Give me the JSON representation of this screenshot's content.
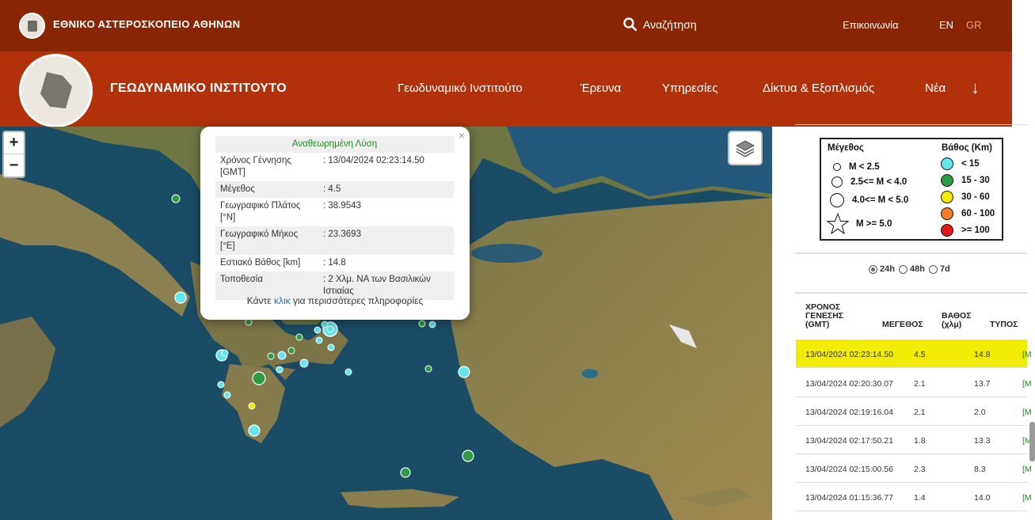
{
  "header": {
    "org_name": "ΕΘΝΙΚΟ ΑΣΤΕΡΟΣΚΟΠΕΙΟ ΑΘΗΝΩΝ",
    "search_label": "Αναζήτηση",
    "contact_label": "Επικοινωνία",
    "lang_en": "EN",
    "lang_gr": "GR"
  },
  "nav": {
    "institute_title": "ΓΕΩΔΥΝΑΜΙΚΟ ΙΝΣΤΙΤΟΥΤΟ",
    "items": [
      "Γεωδυναμικό Ινστιτούτο",
      "Έρευνα",
      "Υπηρεσίες",
      "Δίκτυα & Εξοπλισμός",
      "Νέα"
    ],
    "arrow": "↓"
  },
  "map": {
    "zoom_in": "+",
    "zoom_out": "−",
    "popup": {
      "close": "×",
      "heading": "Αναθεωρημένη Λύση",
      "rows": [
        {
          "label": "Χρόνος Γέννησης [GMT]",
          "value": ": 13/04/2024 02:23:14.50"
        },
        {
          "label": "Μέγεθος",
          "value": ": 4.5"
        },
        {
          "label": "Γεωγραφικό Πλάτος [°N]",
          "value": ": 38.9543"
        },
        {
          "label": "Γεωγραφικό Μήκος [°E]",
          "value": ": 23.3693"
        },
        {
          "label": "Εστιακό Βάθος [km]",
          "value": ": 14.8"
        },
        {
          "label": "Τοποθεσία",
          "value": ": 2 Χλμ. ΝΑ των Βασιλικών Ιστιαίας"
        }
      ],
      "more_prefix": "Κάντε",
      "more_link": "κλικ",
      "more_suffix": "για περισσότερες πληροφορίες"
    }
  },
  "legend": {
    "magnitude_title": "Μέγεθος",
    "depth_title": "Βάθος (Km)",
    "magnitudes": [
      "M < 2.5",
      "2.5<= M < 4.0",
      "4.0<= M < 5.0",
      "M >= 5.0"
    ],
    "depths": [
      {
        "label": "< 15",
        "color": "#64e4ec"
      },
      {
        "label": "15 - 30",
        "color": "#2e9a44"
      },
      {
        "label": "30 - 60",
        "color": "#f2ec04"
      },
      {
        "label": "60 - 100",
        "color": "#f57c28"
      },
      {
        "label": ">= 100",
        "color": "#e31a1c"
      }
    ]
  },
  "filter": {
    "options": [
      "24h",
      "48h",
      "7d"
    ],
    "selected": "24h"
  },
  "events_table": {
    "col_time": "ΧΡΟΝΟΣ ΓΕΝΕΣΗΣ (GMT)",
    "col_time_l1": "ΧΡΟΝΟΣ",
    "col_time_l2": "ΓΕΝΕΣΗΣ",
    "col_time_l3": "(GMT)",
    "col_mag": "ΜΕΓΕΘΟΣ",
    "col_depth_l1": "ΒΑΘΟΣ",
    "col_depth_l2": "(χλμ)",
    "col_type": "ΤΥΠΟΣ",
    "rows": [
      {
        "time": "13/04/2024 02:23:14.50",
        "mag": "4.5",
        "depth": "14.8",
        "type": "[M",
        "highlight": true
      },
      {
        "time": "13/04/2024 02:20:30.07",
        "mag": "2.1",
        "depth": "13.7",
        "type": "[M"
      },
      {
        "time": "13/04/2024 02:19:16.04",
        "mag": "2.1",
        "depth": "2.0",
        "type": "[M"
      },
      {
        "time": "13/04/2024 02:17:50.21",
        "mag": "1.8",
        "depth": "13.3",
        "type": "[M"
      },
      {
        "time": "13/04/2024 02:15:00.56",
        "mag": "2.3",
        "depth": "8.3",
        "type": "[M"
      },
      {
        "time": "13/04/2024 01:15:36.77",
        "mag": "1.4",
        "depth": "14.0",
        "type": "[M"
      }
    ]
  }
}
